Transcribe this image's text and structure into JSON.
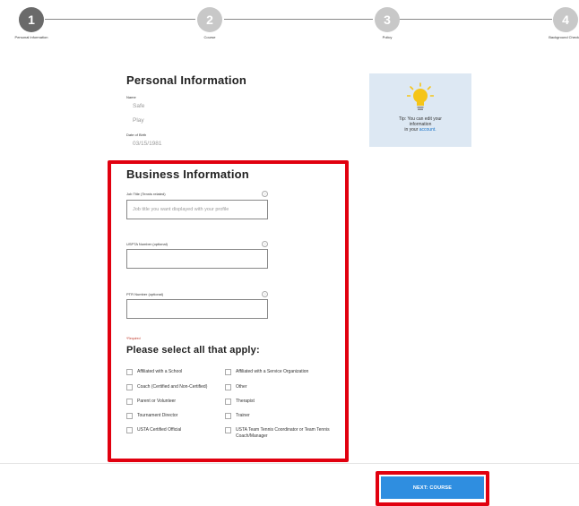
{
  "stepper": {
    "steps": [
      {
        "number": "1",
        "label": "Personal Information",
        "active": true
      },
      {
        "number": "2",
        "label": "Course",
        "active": false
      },
      {
        "number": "3",
        "label": "Policy",
        "active": false
      },
      {
        "number": "4",
        "label": "Background Check",
        "active": false
      }
    ]
  },
  "personal": {
    "title": "Personal Information",
    "name_label": "Name",
    "first_name": "Safe",
    "last_name": "Play",
    "dob_label": "Date of Birth",
    "dob": "03/15/1981"
  },
  "tip": {
    "text_line1": "Tip: You can edit your",
    "text_line2": "information",
    "text_line3_prefix": "in your ",
    "link": "account."
  },
  "business": {
    "title": "Business Information",
    "job_title_label": "Job Title (Tennis related)",
    "job_title_placeholder": "Job title you want displayed with your profile",
    "usta_label": "USPTA Number (optional)",
    "ptr_label": "PTR Number (optional)",
    "help_glyph": "?"
  },
  "apply": {
    "required_note": "*Required",
    "title": "Please select all that apply:",
    "left_options": [
      "Affiliated with a School",
      "Coach (Certified and Non-Certified)",
      "Parent or Volunteer",
      "Tournament Director",
      "USTA Certified Official"
    ],
    "right_options": [
      "Affiliated with a Service Organization",
      "Other",
      "Therapist",
      "Trainer",
      "USTA Team Tennis Coordinator or Team Tennis Coach/Manager"
    ]
  },
  "footer": {
    "next_label": "NEXT: COURSE"
  },
  "colors": {
    "highlight": "#e1000f",
    "primary": "#2f8ee0",
    "tip_bg": "#dde8f3",
    "bulb": "#f5c518"
  },
  "icons": {
    "tip": "lightbulb-icon",
    "help": "help-circle-icon"
  }
}
